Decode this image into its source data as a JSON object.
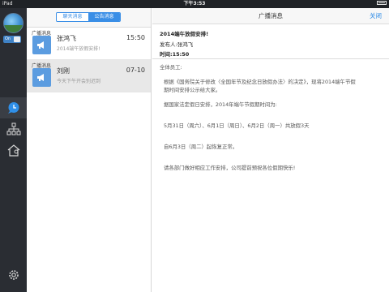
{
  "status_bar": {
    "carrier": "iPad",
    "time": "下午3:53"
  },
  "sidebar": {
    "toggle_label": "On",
    "items": [
      {
        "icon": "chat-bubble-icon",
        "active": true
      },
      {
        "icon": "org-chart-icon",
        "active": false
      },
      {
        "icon": "home-icon",
        "active": false
      }
    ],
    "settings_icon": "gear-icon"
  },
  "list": {
    "tabs": [
      {
        "label": "聊天消息",
        "selected": false
      },
      {
        "label": "公告消息",
        "selected": true
      }
    ],
    "messages": [
      {
        "tag": "广播消息",
        "name": "张鸿飞",
        "time": "15:50",
        "preview": "2014端午放假安排!",
        "selected": false
      },
      {
        "tag": "广播消息",
        "name": "刘刚",
        "time": "07-10",
        "preview": "今天下午开会别迟到",
        "selected": true
      }
    ]
  },
  "detail": {
    "header_title": "广播消息",
    "close_label": "关闭",
    "subject": "2014端午放假安排!",
    "sender": "发布人:张鸿飞",
    "time": "时间:15:50",
    "body": {
      "greeting": "全体员工:",
      "p1_line1": "根据《国务院关于修改〈全国年节及纪念日放假办法〉的决定》，现将2014端午节假",
      "p1_line2": "期时间安排公示给大家。",
      "p2": "据国家法定假日安排，2014年端午节假期时间为:",
      "p3": "5月31日（周六）、6月1日（周日）、6月2日（周一）共放假3天",
      "p4": "自6月3日（周二）起恢复正常。",
      "p5": "请各部门做好相应工作安排，公司提前预祝各位假期快乐!"
    }
  },
  "colors": {
    "accent": "#2a8ae6",
    "rail": "#2a2d33",
    "icon_blue": "#5b9ce0"
  }
}
